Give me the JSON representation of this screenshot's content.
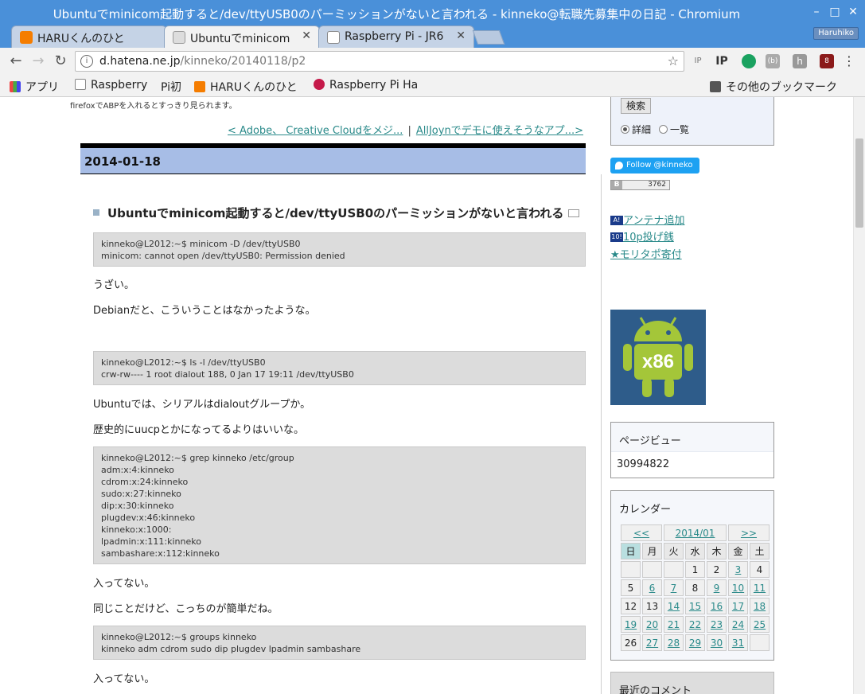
{
  "window": {
    "title": "Ubuntuでminicom起動すると/dev/ttyUSB0のパーミッションがないと言われる - kinneko@転職先募集中の日記 - Chromium",
    "minimize": "–",
    "maximize": "□",
    "close": "✕"
  },
  "tabs": [
    {
      "label": "HARUくんのひと",
      "active": false
    },
    {
      "label": "Ubuntuでminicom",
      "active": true
    },
    {
      "label": "Raspberry Pi - JR6",
      "active": false
    }
  ],
  "tab_close": "✕",
  "profile_name": "Haruhiko",
  "toolbar": {
    "url_host": "d.hatena.ne.jp",
    "url_path": "/kinneko/20140118/p2",
    "extensions": [
      "IP",
      "IP",
      "",
      "(b)",
      "h",
      "8",
      "⋮"
    ]
  },
  "bookmarks": {
    "apps": "アプリ",
    "items": [
      "Raspberry",
      "Pi初",
      "HARUくんのひと",
      "Raspberry Pi Ha"
    ],
    "other": "その他のブックマーク"
  },
  "page": {
    "top_note": "firefoxでABPを入れるとすっきり見られます。",
    "prev_link": "< Adobe、 Creative Cloudをメジ...",
    "separator": "|",
    "next_link": "AllJoynでデモに使えそうなアプ...>",
    "date": "2014-01-18",
    "entry_title": "Ubuntuでminicom起動すると/dev/ttyUSB0のパーミッションがないと言われる",
    "blocks": [
      {
        "type": "code",
        "text": "kinneko@L2012:~$ minicom -D /dev/ttyUSB0\nminicom: cannot open /dev/ttyUSB0: Permission denied"
      },
      {
        "type": "p",
        "text": "うざい。"
      },
      {
        "type": "p",
        "text": "Debianだと、こういうことはなかったような。"
      },
      {
        "type": "code",
        "text": "kinneko@L2012:~$ ls -l /dev/ttyUSB0\ncrw-rw---- 1 root dialout 188, 0 Jan 17 19:11 /dev/ttyUSB0"
      },
      {
        "type": "p",
        "text": "Ubuntuでは、シリアルはdialoutグループか。"
      },
      {
        "type": "p",
        "text": "歴史的にuucpとかになってるよりはいいな。"
      },
      {
        "type": "code",
        "text": "kinneko@L2012:~$ grep kinneko /etc/group\nadm:x:4:kinneko\ncdrom:x:24:kinneko\nsudo:x:27:kinneko\ndip:x:30:kinneko\nplugdev:x:46:kinneko\nkinneko:x:1000:\nlpadmin:x:111:kinneko\nsambashare:x:112:kinneko"
      },
      {
        "type": "p",
        "text": "入ってない。"
      },
      {
        "type": "p",
        "text": "同じことだけど、こっちのが簡単だね。"
      },
      {
        "type": "code",
        "text": "kinneko@L2012:~$ groups kinneko\nkinneko adm cdrom sudo dip plugdev lpadmin sambashare"
      },
      {
        "type": "p",
        "text": "入ってない。"
      }
    ]
  },
  "sidebar": {
    "search_button": "検索",
    "radio_detail": "詳細",
    "radio_list": "一覧",
    "follow": "Follow @kinneko",
    "hb_label": "B",
    "hb_count": "3762",
    "links": [
      {
        "badge": "A!",
        "text": "アンテナ追加"
      },
      {
        "badge": "10!",
        "text": "10p投げ銭"
      },
      {
        "badge": "",
        "text": "★モリタポ寄付"
      }
    ],
    "android_label": "x86",
    "pageview_title": "ページビュー",
    "pageview_count": "30994822",
    "calendar_title": "カレンダー",
    "calendar_prev": "<<",
    "calendar_month": "2014/01",
    "calendar_next": ">>",
    "weekdays": [
      "日",
      "月",
      "火",
      "水",
      "木",
      "金",
      "土"
    ],
    "weeks": [
      [
        "",
        "",
        "",
        "1",
        "2",
        "3",
        "4"
      ],
      [
        "5",
        "6",
        "7",
        "8",
        "9",
        "10",
        "11"
      ],
      [
        "12",
        "13",
        "14",
        "15",
        "16",
        "17",
        "18"
      ],
      [
        "19",
        "20",
        "21",
        "22",
        "23",
        "24",
        "25"
      ],
      [
        "26",
        "27",
        "28",
        "29",
        "30",
        "31",
        ""
      ]
    ],
    "linked_days": [
      "3",
      "6",
      "7",
      "9",
      "10",
      "11",
      "14",
      "15",
      "16",
      "17",
      "18",
      "19",
      "20",
      "21",
      "22",
      "23",
      "24",
      "25",
      "27",
      "28",
      "29",
      "30",
      "31"
    ],
    "recent_comments": "最近のコメント"
  }
}
